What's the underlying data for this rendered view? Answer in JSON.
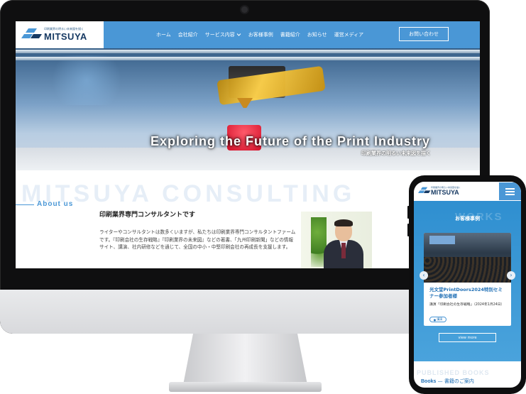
{
  "site": {
    "logo_tagline": "印刷業界の明るい未来図を描く",
    "logo_name": "MITSUYA",
    "nav": [
      "ホーム",
      "会社紹介",
      "サービス内容",
      "お客様事例",
      "書籍紹介",
      "お知らせ",
      "運営メディア"
    ],
    "contact_button": "お問い合わせ",
    "hero_title": "Exploring the Future of the Print Industry",
    "hero_subtitle": "印刷業界の明るい未来図を描く",
    "bg_word": "MITSUYA CONSULTING",
    "about_label": "About us",
    "about_heading": "印刷業界専門コンサルタントです",
    "about_body": "ライターやコンサルタントは数多くいますが、私たちは印刷業界専門コンサルタントファームです。『印刷会社の生存戦略』『印刷業界の未来図』などの著書、「九州印刷新聞」などの情報サイト、講演、社内研修などを通じて、全国の中小・中堅印刷会社の再成長を支援します。"
  },
  "mobile": {
    "logo_tagline": "印刷業界の明るい未来図を描く",
    "logo_name": "MITSUYA",
    "bg_word": "WORKS",
    "section_title": "お客様事例",
    "card_title": "光文堂PrintDoors2024特別セミナー参加者様",
    "card_text": "講演「印刷会社の生存戦略」（2024年1月24日）",
    "card_tag": "講演",
    "view_more": "view more",
    "bg_word2": "PUBLISHED BOOKS",
    "books_label_en": "Books",
    "books_label_jp": "書籍のご案内",
    "arrow_left": "‹",
    "arrow_right": "›"
  },
  "colors": {
    "brand_blue": "#4a97d6",
    "navy": "#173a63"
  }
}
